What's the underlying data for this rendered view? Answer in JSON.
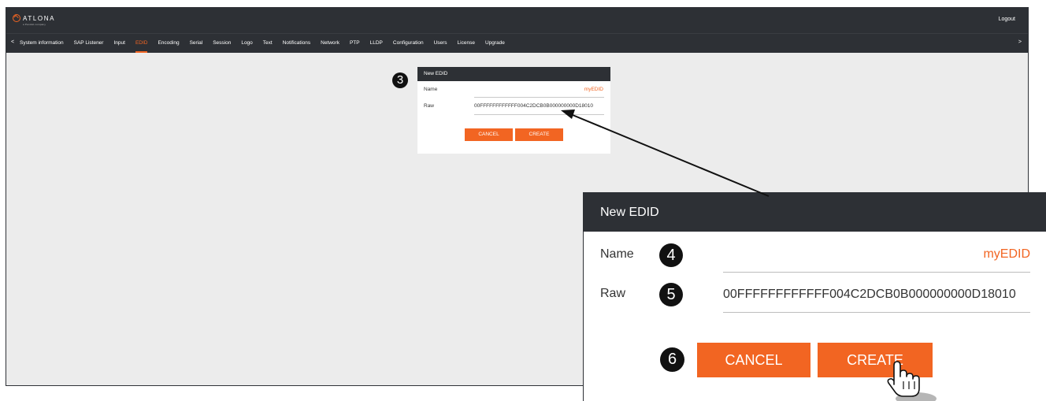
{
  "header": {
    "brand": "ATLONA",
    "brand_sub": "a Panduit company",
    "logout_label": "Logout"
  },
  "nav": {
    "prev": "<",
    "next": ">",
    "active_item": "EDID",
    "items": [
      "System information",
      "SAP Listener",
      "Input",
      "EDID",
      "Encoding",
      "Serial",
      "Session",
      "Logo",
      "Text",
      "Notifications",
      "Network",
      "PTP",
      "LLDP",
      "Configuration",
      "Users",
      "License",
      "Upgrade"
    ]
  },
  "dialog": {
    "title": "New EDID",
    "name_label": "Name",
    "name_value": "myEDID",
    "raw_label": "Raw",
    "raw_value": "00FFFFFFFFFFFF004C2DCB0B000000000D18010",
    "cancel_label": "CANCEL",
    "create_label": "CREATE"
  },
  "steps": {
    "s3": "3",
    "s4": "4",
    "s5": "5",
    "s6": "6"
  },
  "colors": {
    "accent": "#f26522",
    "bar": "#2d3035",
    "workspace": "#ececec"
  },
  "icons": {
    "pointer": "hand-pointer-icon",
    "callout_arrow": "arrow-icon"
  }
}
